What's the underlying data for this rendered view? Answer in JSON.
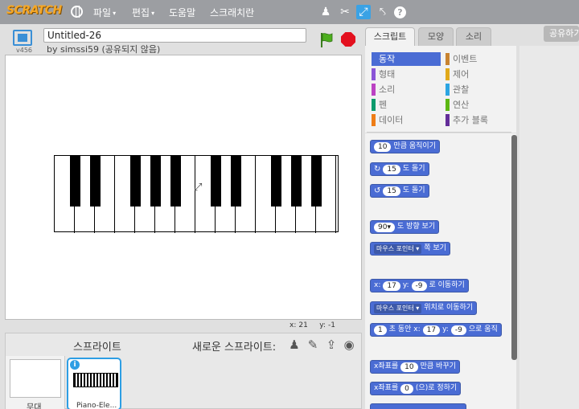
{
  "menubar": {
    "logo": "SCRATCH",
    "items": [
      {
        "label": "파일",
        "caret": "▾"
      },
      {
        "label": "편집",
        "caret": "▾"
      },
      {
        "label": "도움말",
        "caret": ""
      },
      {
        "label": "스크래치란",
        "caret": ""
      }
    ],
    "tools": [
      "duplicate-icon",
      "delete-icon",
      "grow-icon",
      "shrink-icon",
      "help-icon"
    ]
  },
  "stage_header": {
    "version": "v456",
    "project_title": "Untitled-26",
    "byline": "by simssi59 (공유되지 않음)"
  },
  "stage": {
    "coord_x_label": "x:",
    "coord_x": "21",
    "coord_y_label": "y:",
    "coord_y": "-1"
  },
  "sprite_pane": {
    "title": "스프라이트",
    "new_sprite_label": "새로운 스프라이트:",
    "stage_label": "무대",
    "sprites": [
      {
        "name": "Piano-Ele..."
      }
    ]
  },
  "tabs": [
    "스크립트",
    "모양",
    "소리"
  ],
  "share_button": "공유하기",
  "categories": [
    {
      "label": "동작",
      "color": "#4a6cd4"
    },
    {
      "label": "형태",
      "color": "#8a55d7"
    },
    {
      "label": "소리",
      "color": "#bb42c3"
    },
    {
      "label": "펜",
      "color": "#0e9a6c"
    },
    {
      "label": "데이터",
      "color": "#ee7d16"
    },
    {
      "label": "이벤트",
      "color": "#c88330"
    },
    {
      "label": "제어",
      "color": "#e1a91a"
    },
    {
      "label": "관찰",
      "color": "#2ca5e2"
    },
    {
      "label": "연산",
      "color": "#5cb712"
    },
    {
      "label": "추가 블록",
      "color": "#632d99"
    }
  ],
  "blocks": {
    "move": {
      "value": "10",
      "text": "만큼 움직이기"
    },
    "turn_cw": {
      "value": "15",
      "text": "도 돌기"
    },
    "turn_ccw": {
      "value": "15",
      "text": "도 돌기"
    },
    "point_direction": {
      "value": "90",
      "text": "도 방향 보기"
    },
    "point_towards": {
      "dropdown": "마우스 포인터",
      "text": "쪽 보기"
    },
    "goto_xy": {
      "x_label": "x:",
      "x": "17",
      "y_label": "y:",
      "y": "-9",
      "text": "로 이동하기"
    },
    "goto_target": {
      "dropdown": "마우스 포인터",
      "text": "위치로 이동하기"
    },
    "glide": {
      "secs": "1",
      "t1": "초 동안 x:",
      "x": "17",
      "y_label": "y:",
      "y": "-9",
      "t2": "으로 움직"
    },
    "change_x": {
      "pre": "x좌표를",
      "value": "10",
      "text": "만큼 바꾸기"
    },
    "set_x": {
      "pre": "x좌표를",
      "value": "0",
      "text": "(으)로 정하기"
    }
  }
}
